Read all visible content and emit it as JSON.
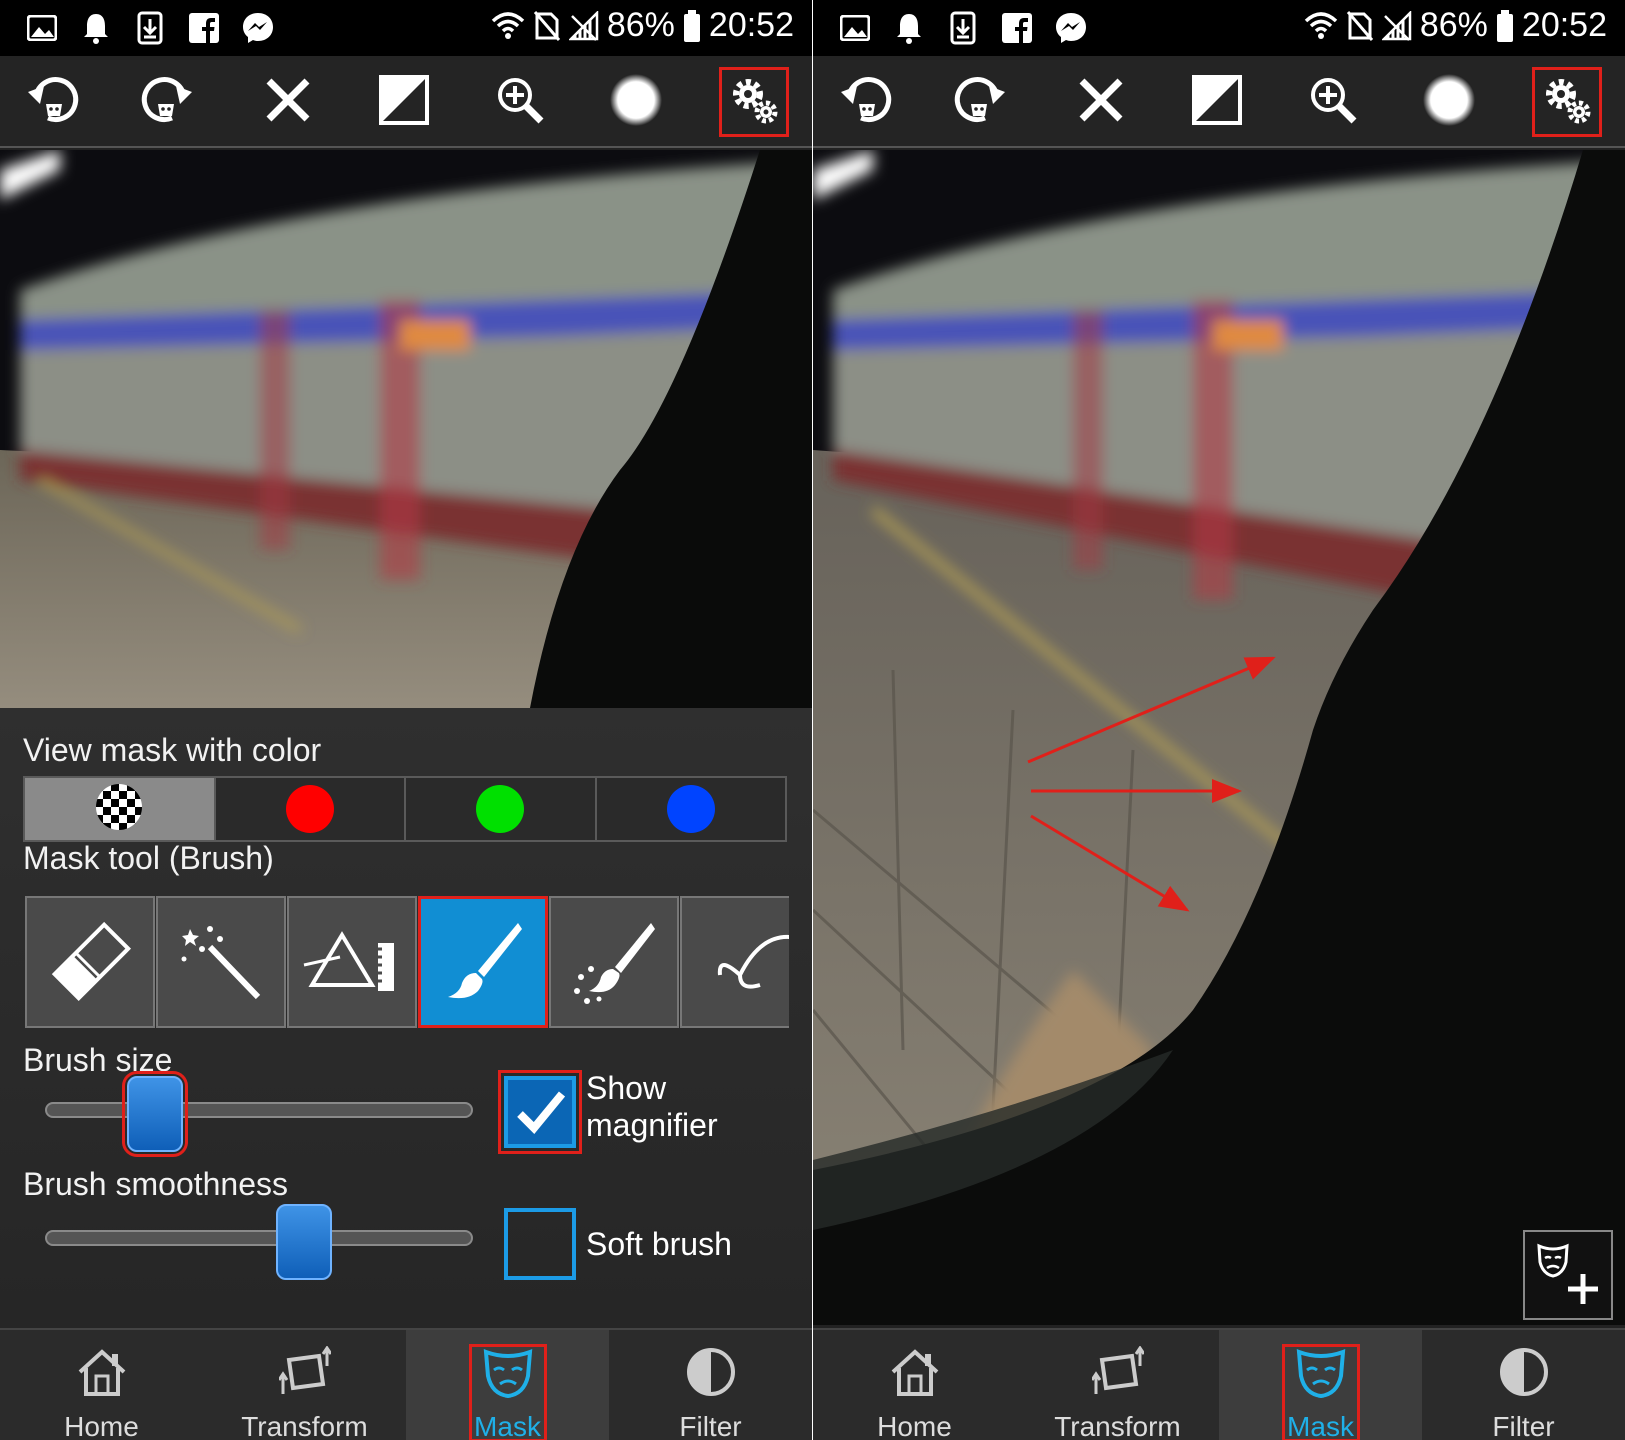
{
  "status_bar": {
    "battery": "86%",
    "time": "20:52"
  },
  "toolbar": {
    "icons": [
      "undo-icon",
      "redo-icon",
      "clear-icon",
      "invert-icon",
      "zoom-in-icon",
      "brush-preview-icon",
      "settings-icon"
    ]
  },
  "panel": {
    "view_mask_label": "View mask with color",
    "mask_colors": [
      "#000000",
      "#ff0000",
      "#00e000",
      "#0044ff"
    ],
    "mask_tool_label": "Mask tool (Brush)",
    "tools": [
      "eraser-tool",
      "magic-wand-tool",
      "prism-tool",
      "brush-tool",
      "sparkle-brush-tool",
      "lasso-tool"
    ],
    "brush_size_label": "Brush size",
    "brush_size_value": 0.25,
    "brush_smoothness_label": "Brush smoothness",
    "brush_smoothness_value": 0.6,
    "show_magnifier_label_1": "Show",
    "show_magnifier_label_2": "magnifier",
    "show_magnifier_checked": true,
    "soft_brush_label": "Soft brush",
    "soft_brush_checked": false
  },
  "nav": {
    "home": "Home",
    "transform": "Transform",
    "mask": "Mask",
    "filter": "Filter"
  },
  "colors": {
    "accent": "#1fb0e8",
    "highlight": "#e0201a",
    "selected_tool": "#118ed3"
  }
}
